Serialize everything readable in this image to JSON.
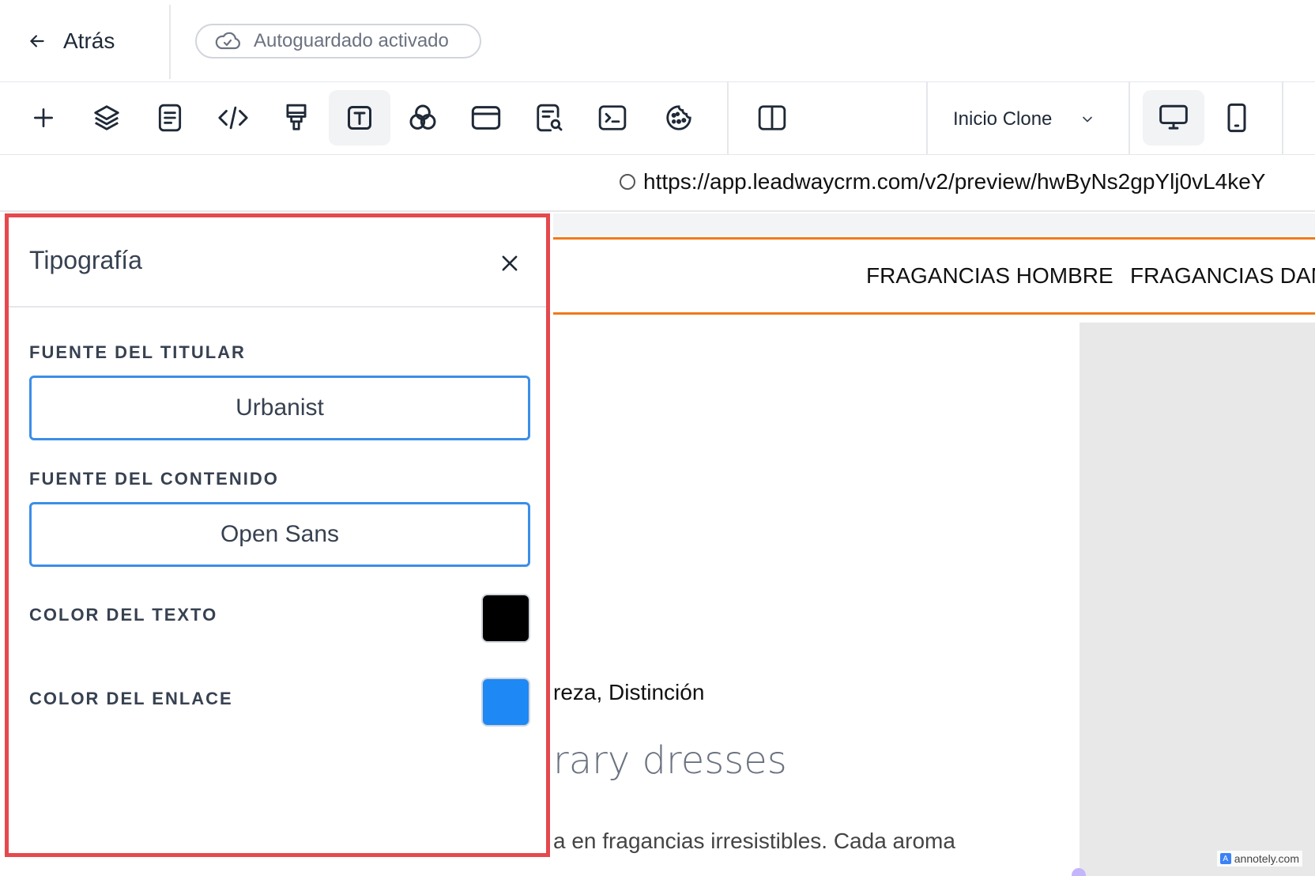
{
  "header": {
    "back_label": "Atrás",
    "autosave_label": "Autoguardado activado"
  },
  "toolbar": {
    "tools": [
      {
        "icon": "plus-icon"
      },
      {
        "icon": "layers-icon"
      },
      {
        "icon": "document-icon"
      },
      {
        "icon": "code-icon"
      },
      {
        "icon": "paint-brush-icon"
      },
      {
        "icon": "typography-icon",
        "active": true
      },
      {
        "icon": "color-circles-icon"
      },
      {
        "icon": "browser-window-icon"
      },
      {
        "icon": "seo-search-icon"
      },
      {
        "icon": "terminal-icon"
      },
      {
        "icon": "cookie-icon"
      },
      {
        "icon": "split-view-icon"
      },
      {
        "icon": "desktop-icon",
        "active": true
      },
      {
        "icon": "mobile-icon"
      }
    ],
    "page_select": "Inicio Clone"
  },
  "url_bar": {
    "url": "https://app.leadwaycrm.com/v2/preview/hwByNs2gpYlj0vL4keY"
  },
  "preview": {
    "nav_items": [
      "FRAGANCIAS HOMBRE",
      "FRAGANCIAS DAM"
    ],
    "tagline": "reza, Distinción",
    "heading": "rary dresses",
    "body": "a en fragancias irresistibles. Cada aroma",
    "watermark": "annotely.com"
  },
  "typography_panel": {
    "title": "Tipografía",
    "headline_font_label": "FUENTE DEL TITULAR",
    "headline_font": "Urbanist",
    "content_font_label": "FUENTE DEL CONTENIDO",
    "content_font": "Open Sans",
    "text_color_label": "COLOR DEL TEXTO",
    "text_color": "#000000",
    "link_color_label": "COLOR DEL ENLACE",
    "link_color": "#1e88f5"
  },
  "colors": {
    "highlight_border": "#e5484d",
    "accent_orange": "#f07a1a",
    "input_border": "#3b8ee8"
  }
}
